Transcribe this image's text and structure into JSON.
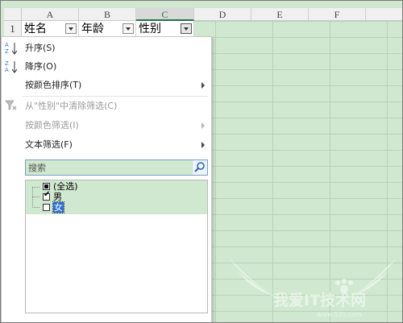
{
  "columns": [
    "A",
    "B",
    "C",
    "D",
    "E",
    "F"
  ],
  "row_number": "1",
  "row1_cells": [
    "姓名",
    "年龄",
    "性别"
  ],
  "menu": {
    "sort_asc": "升序(S)",
    "sort_desc": "降序(O)",
    "sort_by_color": "按颜色排序(T)",
    "clear_filter": "从\"性别\"中清除筛选(C)",
    "filter_by_color": "按颜色筛选(I)",
    "text_filter": "文本筛选(F)",
    "search_placeholder": "搜索",
    "items": [
      {
        "label": "(全选)",
        "state": "partial"
      },
      {
        "label": "男",
        "state": "checked"
      },
      {
        "label": "女",
        "state": "unchecked"
      }
    ]
  },
  "watermark": {
    "text": "我爱IT技术网",
    "url": "www.52ij.com"
  },
  "colors": {
    "grid_bg": "#cfe8cf",
    "excel_green": "#217346",
    "selection_blue": "#2f6fd6"
  }
}
